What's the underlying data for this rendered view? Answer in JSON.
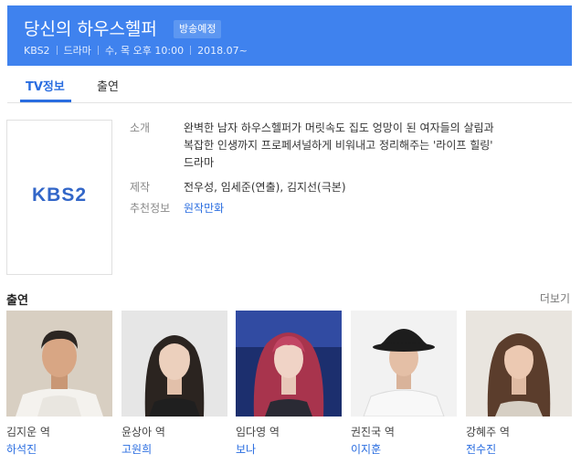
{
  "header": {
    "title": "당신의 하우스헬퍼",
    "badge": "방송예정",
    "meta": [
      "KBS2",
      "드라마",
      "수, 목 오후 10:00",
      "2018.07~"
    ]
  },
  "tabs": [
    {
      "label": "TV정보",
      "active": true
    },
    {
      "label": "출연",
      "active": false
    }
  ],
  "poster": {
    "logo_text": "KBS2"
  },
  "info": {
    "intro_label": "소개",
    "intro_lines": [
      "완벽한 남자 하우스헬퍼가 머릿속도 집도 엉망이 된 여자들의 살림과",
      "복잡한 인생까지 프로페셔널하게 비워내고 정리해주는 '라이프 힐링'",
      "드라마"
    ],
    "production_label": "제작",
    "production_value": "전우성, 임세준(연출), 김지선(극본)",
    "recommend_label": "추천정보",
    "recommend_value": "원작만화"
  },
  "cast_section": {
    "title": "출연",
    "more": "더보기",
    "members": [
      {
        "role": "김지운 역",
        "actor": "하석진"
      },
      {
        "role": "윤상아 역",
        "actor": "고원희"
      },
      {
        "role": "임다영 역",
        "actor": "보나"
      },
      {
        "role": "권진국 역",
        "actor": "이지훈"
      },
      {
        "role": "강혜주 역",
        "actor": "전수진"
      }
    ]
  },
  "colors": {
    "header_bg": "#3f82ee",
    "accent": "#2a6de0"
  }
}
